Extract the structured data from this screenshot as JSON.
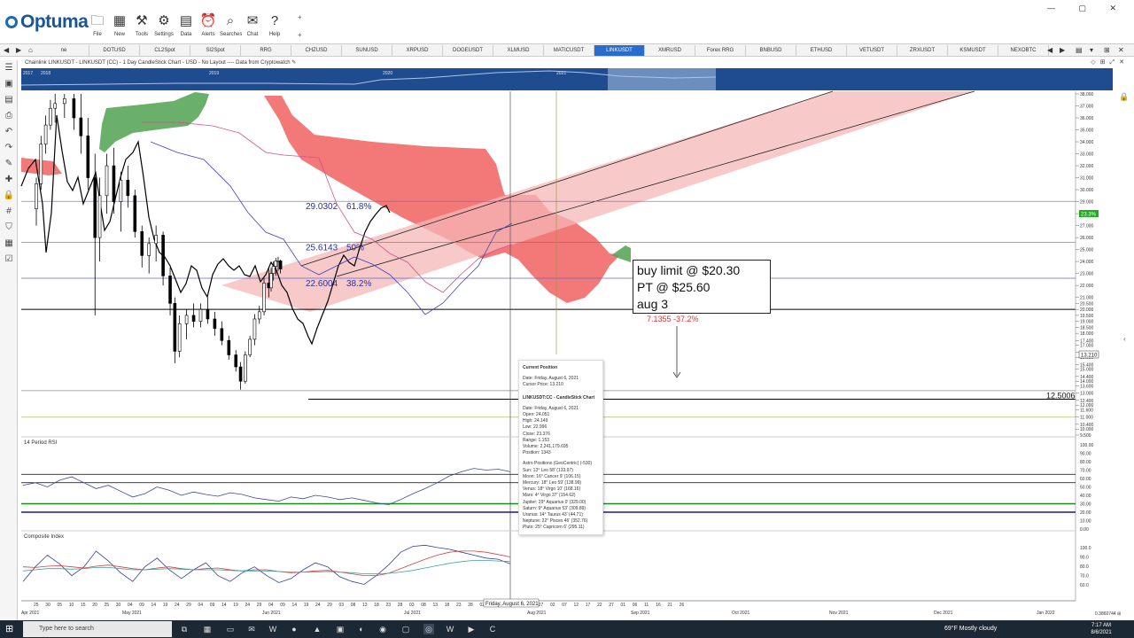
{
  "app": {
    "name": "Optuma",
    "window_controls": "— ▢ ✕"
  },
  "ribbon": [
    {
      "id": "file",
      "label": "File",
      "icon": "folder-icon"
    },
    {
      "id": "new",
      "label": "New",
      "icon": "new-icon"
    },
    {
      "id": "tools",
      "label": "Tools",
      "icon": "tools-icon"
    },
    {
      "id": "settings",
      "label": "Settings",
      "icon": "gear-icon"
    },
    {
      "id": "data",
      "label": "Data",
      "icon": "data-icon"
    },
    {
      "id": "alerts",
      "label": "Alerts",
      "icon": "alarm-icon"
    },
    {
      "id": "searches",
      "label": "Searches",
      "icon": "search-icon"
    },
    {
      "id": "chat",
      "label": "Chat",
      "icon": "chat-icon"
    },
    {
      "id": "help",
      "label": "Help",
      "icon": "help-icon"
    }
  ],
  "tabs": [
    "ne",
    "DOTUSD",
    "CL2Spot",
    "SI2Spot",
    "RRG",
    "CHZUSD",
    "SUNUSD",
    "XRPUSD",
    "DOGEUSDT",
    "XLMUSD",
    "MATICUSDT",
    "LINKUSDT",
    "XMRUSD",
    "Forex RRG",
    "BNBUSD",
    "ETHUSD",
    "VETUSDT",
    "ZRXUSDT",
    "KSMUSDT",
    "NEXOBTC"
  ],
  "active_tab": "LINKUSDT",
  "chart_header": "Chainlink LINKUSDT - LINKUSDT (CC) - 1 Day CandleStick Chart - USD - No Layout ---- Data from Cryptowatch",
  "chart_data": [
    {
      "type": "candlestick",
      "symbol": "LINKUSDT",
      "ylim": [
        9.5,
        38.0
      ],
      "y_ticks": [
        "38.000",
        "37.000",
        "36.000",
        "35.000",
        "34.000",
        "33.000",
        "32.000",
        "31.000",
        "30.000",
        "29.000",
        "28.000",
        "27.000",
        "26.000",
        "25.000",
        "24.000",
        "23.000",
        "22.000",
        "21.000",
        "20.500",
        "20.000",
        "19.500",
        "19.000",
        "18.500",
        "18.000",
        "17.400",
        "17.000",
        "16.400",
        "16.000",
        "15.400",
        "15.000",
        "14.400",
        "14.000",
        "13.600",
        "13.000",
        "12.400",
        "12.000",
        "11.600",
        "11.000",
        "10.400",
        "10.000",
        "9.500"
      ],
      "x_ticks": [
        "25",
        "30",
        "05",
        "10",
        "15",
        "20",
        "25",
        "30",
        "04",
        "09",
        "14",
        "19",
        "24",
        "29",
        "04",
        "09",
        "14",
        "19",
        "24",
        "29",
        "04",
        "09",
        "14",
        "19",
        "24",
        "29",
        "03",
        "08",
        "13",
        "18",
        "23",
        "28",
        "03",
        "08",
        "13",
        "18",
        "23",
        "28",
        "02",
        "07",
        "12",
        "17",
        "22",
        "27",
        "02",
        "07",
        "12",
        "17",
        "22",
        "27",
        "01",
        "06",
        "11",
        "16",
        "21",
        "26"
      ],
      "month_labels": [
        "Apr 2021",
        "May 2021",
        "Jun 2021",
        "Jul 2021",
        "Aug 2021",
        "Sep 2021",
        "Oct 2021",
        "Nov 2021",
        "Dec 2021",
        "Jan 2022"
      ],
      "overview_years": [
        "2017",
        "2018",
        "2019",
        "2020",
        "2021"
      ],
      "candles": [
        {
          "date": "2021-04-24",
          "open": 28.4,
          "high": 31.0,
          "low": 27.0,
          "close": 30.5
        },
        {
          "date": "2021-04-26",
          "open": 30.5,
          "high": 34.5,
          "low": 30.0,
          "close": 33.8
        },
        {
          "date": "2021-04-28",
          "open": 33.8,
          "high": 36.2,
          "low": 33.0,
          "close": 35.4
        },
        {
          "date": "2021-04-30",
          "open": 35.4,
          "high": 37.5,
          "low": 35.0,
          "close": 36.8
        },
        {
          "date": "2021-05-02",
          "open": 36.8,
          "high": 38.0,
          "low": 35.6,
          "close": 37.2
        },
        {
          "date": "2021-05-06",
          "open": 37.2,
          "high": 38.0,
          "low": 36.0,
          "close": 37.6
        },
        {
          "date": "2021-05-10",
          "open": 37.6,
          "high": 38.0,
          "low": 35.0,
          "close": 36.0
        },
        {
          "date": "2021-05-13",
          "open": 36.0,
          "high": 38.0,
          "low": 33.0,
          "close": 34.5
        },
        {
          "date": "2021-05-16",
          "open": 34.5,
          "high": 36.0,
          "low": 30.0,
          "close": 31.0
        },
        {
          "date": "2021-05-19",
          "open": 31.0,
          "high": 33.0,
          "low": 19.5,
          "close": 26.0
        },
        {
          "date": "2021-05-21",
          "open": 26.0,
          "high": 31.0,
          "low": 24.0,
          "close": 29.5
        },
        {
          "date": "2021-05-24",
          "open": 29.5,
          "high": 33.0,
          "low": 28.0,
          "close": 32.0
        },
        {
          "date": "2021-05-27",
          "open": 32.0,
          "high": 33.5,
          "low": 28.0,
          "close": 29.0
        },
        {
          "date": "2021-05-30",
          "open": 29.0,
          "high": 31.5,
          "low": 26.5,
          "close": 30.8
        },
        {
          "date": "2021-06-02",
          "open": 30.8,
          "high": 32.0,
          "low": 28.5,
          "close": 29.5
        },
        {
          "date": "2021-06-05",
          "open": 29.5,
          "high": 30.0,
          "low": 26.0,
          "close": 26.5
        },
        {
          "date": "2021-06-08",
          "open": 26.5,
          "high": 27.0,
          "low": 23.5,
          "close": 24.5
        },
        {
          "date": "2021-06-11",
          "open": 24.5,
          "high": 26.0,
          "low": 23.0,
          "close": 25.5
        },
        {
          "date": "2021-06-14",
          "open": 25.5,
          "high": 27.0,
          "low": 24.0,
          "close": 26.2
        },
        {
          "date": "2021-06-17",
          "open": 26.2,
          "high": 26.5,
          "low": 22.0,
          "close": 22.8
        },
        {
          "date": "2021-06-20",
          "open": 22.8,
          "high": 23.5,
          "low": 19.5,
          "close": 20.5
        },
        {
          "date": "2021-06-22",
          "open": 20.5,
          "high": 21.0,
          "low": 15.5,
          "close": 16.5
        },
        {
          "date": "2021-06-24",
          "open": 16.5,
          "high": 19.5,
          "low": 16.0,
          "close": 18.8
        },
        {
          "date": "2021-06-27",
          "open": 18.8,
          "high": 20.0,
          "low": 17.5,
          "close": 19.5
        },
        {
          "date": "2021-06-30",
          "open": 19.5,
          "high": 20.5,
          "low": 18.5,
          "close": 19.0
        },
        {
          "date": "2021-07-03",
          "open": 19.0,
          "high": 20.5,
          "low": 18.5,
          "close": 20.0
        },
        {
          "date": "2021-07-06",
          "open": 20.0,
          "high": 21.0,
          "low": 18.8,
          "close": 19.2
        },
        {
          "date": "2021-07-09",
          "open": 19.2,
          "high": 19.8,
          "low": 17.8,
          "close": 18.4
        },
        {
          "date": "2021-07-12",
          "open": 18.4,
          "high": 19.0,
          "low": 17.0,
          "close": 17.4
        },
        {
          "date": "2021-07-15",
          "open": 17.4,
          "high": 17.8,
          "low": 15.8,
          "close": 16.2
        },
        {
          "date": "2021-07-18",
          "open": 16.2,
          "high": 16.6,
          "low": 14.8,
          "close": 15.2
        },
        {
          "date": "2021-07-20",
          "open": 15.2,
          "high": 15.6,
          "low": 13.3,
          "close": 14.0
        },
        {
          "date": "2021-07-22",
          "open": 14.0,
          "high": 16.5,
          "low": 13.8,
          "close": 16.2
        },
        {
          "date": "2021-07-24",
          "open": 16.2,
          "high": 17.8,
          "low": 16.0,
          "close": 17.5
        },
        {
          "date": "2021-07-26",
          "open": 17.5,
          "high": 19.6,
          "low": 17.0,
          "close": 19.2
        },
        {
          "date": "2021-07-28",
          "open": 19.2,
          "high": 20.3,
          "low": 18.8,
          "close": 19.8
        },
        {
          "date": "2021-07-30",
          "open": 19.8,
          "high": 22.6,
          "low": 19.5,
          "close": 22.2
        },
        {
          "date": "2021-08-01",
          "open": 22.2,
          "high": 23.5,
          "low": 21.0,
          "close": 21.8
        },
        {
          "date": "2021-08-02",
          "open": 21.8,
          "high": 23.5,
          "low": 21.5,
          "close": 23.0
        },
        {
          "date": "2021-08-03",
          "open": 23.0,
          "high": 24.0,
          "low": 22.4,
          "close": 23.6
        },
        {
          "date": "2021-08-04",
          "open": 23.6,
          "high": 24.3,
          "low": 22.8,
          "close": 24.05
        },
        {
          "date": "2021-08-05",
          "open": 24.05,
          "high": 24.4,
          "low": 23.2,
          "close": 24.05
        },
        {
          "date": "2021-08-06",
          "open": 24.051,
          "high": 24.149,
          "low": 22.996,
          "close": 23.376
        }
      ],
      "fib_levels": [
        {
          "price": 29.0302,
          "label": "29.0302",
          "pct": "61.8%"
        },
        {
          "price": 25.6143,
          "label": "25.6143",
          "pct": "50%"
        },
        {
          "price": 22.6004,
          "label": "22.6004",
          "pct": "38.2%"
        }
      ],
      "horizontal_levels": [
        {
          "price": 20.0,
          "color": "#000000"
        },
        {
          "price": 12.5006,
          "label": "12.5006",
          "color": "#000000"
        },
        {
          "price": 13.21,
          "color": "#888888"
        },
        {
          "price": 11.0,
          "color": "#b8b870"
        }
      ],
      "projection_label": {
        "value": "7.1355",
        "pct": "-37.2%",
        "color": "#e03030"
      },
      "current_price_tag": "23.3%",
      "cursor_price_tag": "13.210",
      "cursor_date_tag": "Friday, August 6, 2021"
    },
    {
      "type": "line",
      "title": "14 Period RSI",
      "ylim": [
        0,
        100
      ],
      "y_ticks": [
        "100.00",
        "90.00",
        "80.00",
        "70.00",
        "60.00",
        "50.00",
        "40.00",
        "30.00",
        "20.00",
        "10.00",
        "0.00"
      ],
      "levels": [
        {
          "value": 65,
          "color": "#000000"
        },
        {
          "value": 55,
          "color": "#000000"
        },
        {
          "value": 30,
          "color": "#1a8a1a"
        },
        {
          "value": 20,
          "color": "#1a1a8a"
        }
      ],
      "values": [
        52,
        55,
        50,
        58,
        62,
        55,
        48,
        52,
        45,
        38,
        42,
        50,
        46,
        40,
        44,
        41,
        39,
        43,
        41,
        37,
        35,
        33,
        38,
        36,
        40,
        38,
        35,
        37,
        34,
        31,
        29,
        35,
        42,
        48,
        55,
        63,
        68,
        72,
        70,
        71,
        68
      ]
    },
    {
      "type": "line",
      "title": "Composite Index",
      "y_ticks": [
        "100.0",
        "90.0",
        "80.0",
        "70.0",
        "60.0"
      ],
      "series": [
        {
          "values": [
            30,
            55,
            75,
            60,
            40,
            55,
            82,
            65,
            45,
            30,
            55,
            70,
            50,
            35,
            50,
            62,
            40,
            30,
            45,
            55,
            40,
            28,
            35,
            50,
            62,
            55,
            38,
            30,
            25,
            40,
            58,
            80,
            90,
            92,
            88,
            85,
            80,
            75,
            70,
            68,
            60
          ]
        },
        {
          "values": [
            55,
            54,
            56,
            57,
            55,
            53,
            56,
            58,
            55,
            52,
            50,
            53,
            55,
            52,
            50,
            52,
            53,
            50,
            48,
            50,
            50,
            47,
            45,
            46,
            48,
            49,
            46,
            43,
            40,
            40,
            44,
            52,
            60,
            68,
            75,
            80,
            82,
            82,
            80,
            76,
            72
          ]
        },
        {
          "values": [
            48,
            50,
            52,
            52,
            51,
            52,
            54,
            54,
            52,
            50,
            50,
            51,
            52,
            51,
            50,
            50,
            50,
            49,
            48,
            48,
            48,
            47,
            46,
            46,
            46,
            47,
            46,
            45,
            43,
            43,
            44,
            46,
            49,
            53,
            57,
            61,
            64,
            66,
            66,
            65,
            64
          ]
        }
      ]
    }
  ],
  "trade_note": {
    "line1": "buy limit @ $20.30",
    "line2": "PT @ $25.60",
    "line3": "aug 3"
  },
  "tooltip": {
    "title": "Current Position",
    "date": "Date: Friday, August 6, 2021",
    "cursor": "Cursor Price: 13.210",
    "section": "LINKUSDT:CC - CandleStick Chart",
    "c_date": "Date: Friday, August 6, 2021",
    "open": "Open: 24.051",
    "high": "High: 24.149",
    "low": "Low: 22.996",
    "close": "Close: 23.376",
    "range": "Range: 1.153",
    "volume": "Volume: 2,241,179.695",
    "position": "Position: 1343",
    "astro_title": "Astro Positions (GeoCentric) (-530)",
    "astro": [
      "Sun: 13° Leo 58' (133.97)",
      "Moon: 16° Cancer 9' (106.15)",
      "Mercury: 18° Leo 59' (138.99)",
      "Venus: 18° Virgo 10' (168.16)",
      "Mars: 4° Virgo 37' (154.62)",
      "Jupiter: 29° Aquarius 0' (329.00)",
      "Saturn: 9° Aquarius 53' (309.89)",
      "Uranus: 14° Taurus 43' (44.71)",
      "Neptune: 22° Pisces 46' (352.76)",
      "Pluto: 25° Capricorn 6' (295.11)"
    ]
  },
  "bottom_right_value": "0.3860744 ⊞",
  "taskbar": {
    "search_placeholder": "Type here to search",
    "weather": "69°F  Mostly cloudy",
    "time": "7:17 AM",
    "date": "8/6/2021"
  },
  "colors": {
    "tab_active": "#2a6ccb",
    "cloud_red": "#f26a6a",
    "cloud_green": "#5aa65a",
    "channel_fill": "#f6b7b7",
    "fib_text": "#2233aa",
    "taskbar": "#1c2833"
  }
}
